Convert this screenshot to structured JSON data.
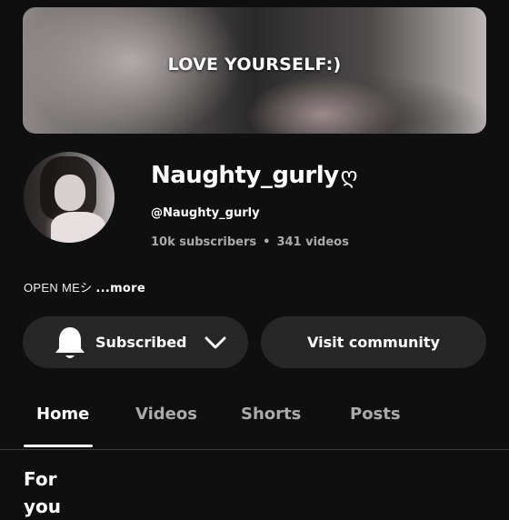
{
  "banner": {
    "text": "LOVE YOURSELF:)"
  },
  "channel": {
    "name": "Naughty_gurly",
    "name_decoration": "ღ",
    "handle": "@Naughty_gurly",
    "subscribers": "10k subscribers",
    "separator": "•",
    "videos": "341 videos"
  },
  "description": {
    "text": "OPEN MEシ",
    "more_label": "...more"
  },
  "actions": {
    "subscribed_label": "Subscribed",
    "community_label": "Visit community",
    "icons": [
      "bell-icon",
      "chevron-down-icon"
    ]
  },
  "tabs": [
    {
      "label": "Home",
      "active": true
    },
    {
      "label": "Videos",
      "active": false
    },
    {
      "label": "Shorts",
      "active": false
    },
    {
      "label": "Posts",
      "active": false
    }
  ],
  "section": {
    "title": "For you"
  },
  "colors": {
    "background": "#0f0f0f",
    "button": "#272727",
    "muted_text": "#aaaaaa"
  }
}
